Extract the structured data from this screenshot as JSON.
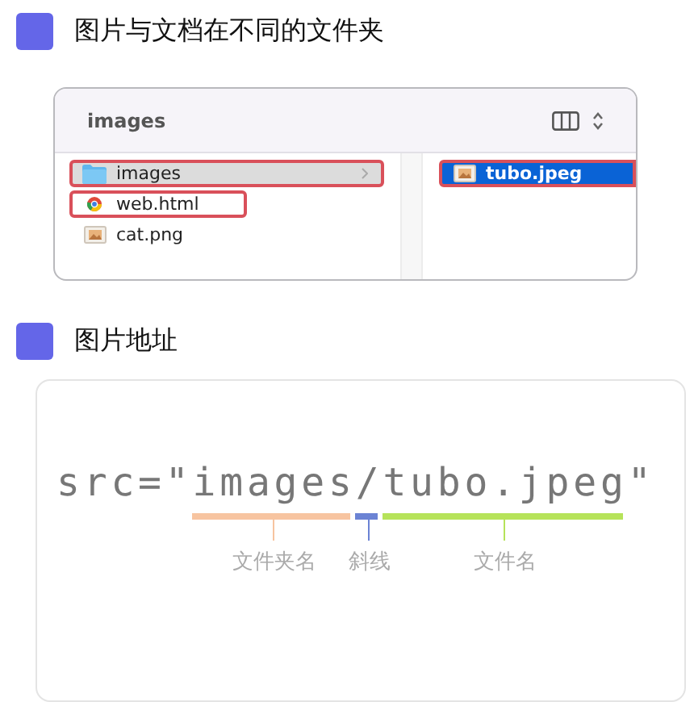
{
  "section_1": {
    "title": "图片与文档在不同的文件夹"
  },
  "finder": {
    "title": "images",
    "columns": [
      {
        "focused": false,
        "items": [
          {
            "name": "images",
            "kind": "folder",
            "selected": true,
            "highlighted": true
          },
          {
            "name": "web.html",
            "kind": "html",
            "selected": false,
            "highlighted": true
          },
          {
            "name": "cat.png",
            "kind": "image",
            "selected": false,
            "highlighted": false
          }
        ]
      },
      {
        "focused": true,
        "items": [
          {
            "name": "tubo.jpeg",
            "kind": "image",
            "selected": true,
            "highlighted": true
          }
        ]
      }
    ]
  },
  "section_2": {
    "title": "图片地址"
  },
  "code": {
    "parts": [
      {
        "text": "src=\""
      },
      {
        "text": "images",
        "label": "文件夹名",
        "color": "#f7c4a0"
      },
      {
        "text": "/",
        "label": "斜线",
        "color": "#6b83d4"
      },
      {
        "text": "tubo.jpeg",
        "label": "文件名",
        "color": "#b6e35a"
      },
      {
        "text": "\""
      }
    ]
  }
}
